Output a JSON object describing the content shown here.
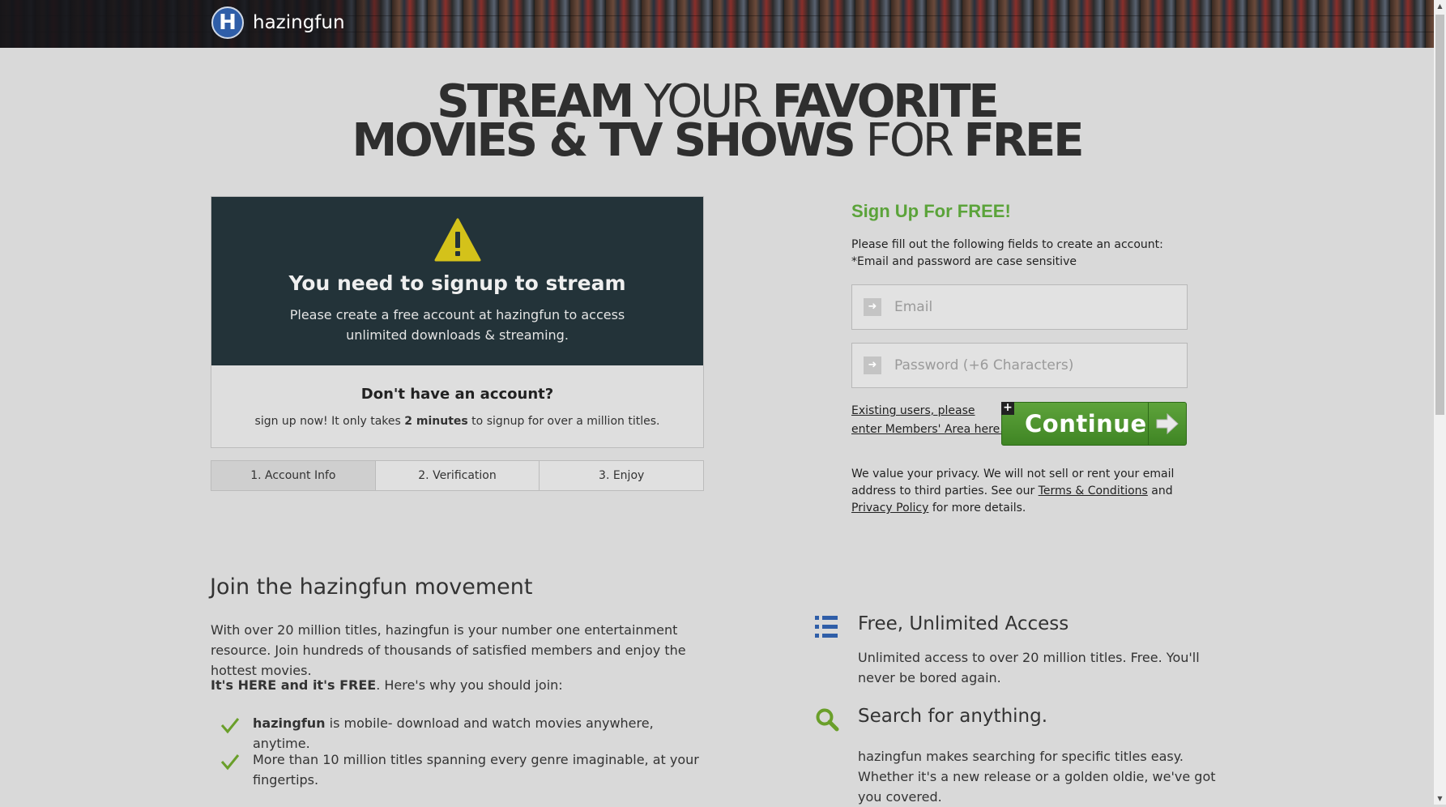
{
  "header": {
    "logo_letter": "H",
    "site_name": "hazingfun"
  },
  "headline": {
    "line1_a": "STREAM",
    "line1_b": "YOUR",
    "line1_c": "FAVORITE",
    "line2_a": "MOVIES & TV SHOWS",
    "line2_b": "FOR",
    "line2_c": "FREE"
  },
  "alert": {
    "icon": "warning-triangle-icon",
    "title": "You need to signup to stream",
    "text": "Please create a free account at hazingfun to access unlimited downloads & streaming."
  },
  "account": {
    "title": "Don't have an account?",
    "text_before": "sign up now! It only takes ",
    "text_bold": "2 minutes",
    "text_after": " to signup for over a million titles."
  },
  "steps": [
    "1. Account Info",
    "2. Verification",
    "3. Enjoy"
  ],
  "signup": {
    "title": "Sign Up For FREE!",
    "intro_line1": "Please fill out the following fields to create an account:",
    "intro_line2": "*Email and password are case sensitive",
    "email_placeholder": "Email",
    "password_placeholder": "Password (+6 Characters)",
    "existing_link": "Existing users, please enter Members' Area here.",
    "continue_label": "Continue",
    "privacy_before": "We value your privacy. We will not sell or rent your email address to third parties. See our ",
    "terms_link": "Terms & Conditions",
    "privacy_mid": " and ",
    "privacy_link": "Privacy Policy",
    "privacy_after": " for more details."
  },
  "movement": {
    "title": "Join the hazingfun movement",
    "text": "With over 20 million titles, hazingfun is your number one entertainment resource. Join hundreds of thousands of satisfied members and enjoy the hottest movies.",
    "why_bold": "It's HERE and it's FREE",
    "why_rest": ". Here's why you should join:",
    "items": [
      {
        "bold": "hazingfun",
        "text": " is mobile- download and watch movies anywhere, anytime."
      },
      {
        "bold": "",
        "text": "More than 10 million titles spanning every genre imaginable, at your fingertips."
      }
    ]
  },
  "features": [
    {
      "icon": "list-icon",
      "title": "Free, Unlimited Access",
      "text": "Unlimited access to over 20 million titles. Free. You'll never be bored again."
    },
    {
      "icon": "search-icon",
      "title": "Search for anything.",
      "text": "hazingfun makes searching for specific titles easy. Whether it's a new release or a golden oldie, we've got you covered."
    }
  ],
  "colors": {
    "accent_green": "#5ba33a",
    "alert_bg": "#233339",
    "warning_yellow": "#d4c21a",
    "list_icon_blue": "#2f5ea8",
    "search_icon_green": "#6a9f2a"
  }
}
